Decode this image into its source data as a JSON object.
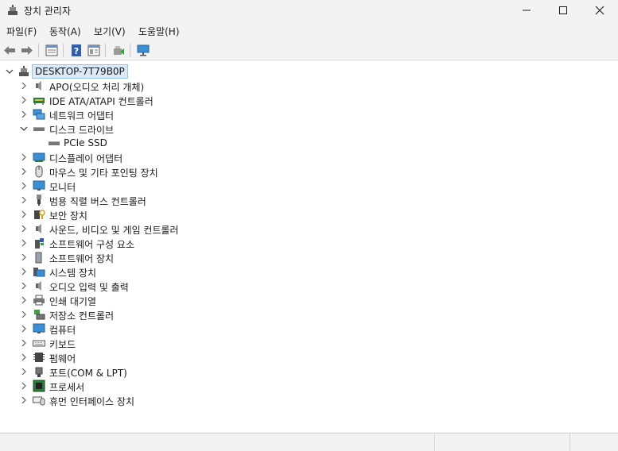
{
  "window": {
    "title": "장치 관리자"
  },
  "menu": [
    {
      "label": "파일(F)"
    },
    {
      "label": "동작(A)"
    },
    {
      "label": "보기(V)"
    },
    {
      "label": "도움말(H)"
    }
  ],
  "toolbar": {
    "icons": [
      "back-arrow-icon",
      "forward-arrow-icon",
      "properties-icon",
      "help-icon",
      "view-icon",
      "update-driver-icon",
      "monitor-scan-icon"
    ]
  },
  "tree": {
    "root": {
      "label": "DESKTOP-7T79B0P",
      "expanded": true
    },
    "categories": [
      {
        "label": "APO(오디오 처리 개체)",
        "expanded": false,
        "icon": "speaker-icon"
      },
      {
        "label": "IDE ATA/ATAPI 컨트롤러",
        "expanded": false,
        "icon": "ide-controller-icon"
      },
      {
        "label": "네트워크 어댑터",
        "expanded": false,
        "icon": "network-adapter-icon"
      },
      {
        "label": "디스크 드라이브",
        "expanded": true,
        "icon": "disk-drive-icon",
        "children": [
          {
            "label": "PCIe SSD",
            "icon": "disk-drive-icon"
          }
        ]
      },
      {
        "label": "디스플레이 어댑터",
        "expanded": false,
        "icon": "display-adapter-icon"
      },
      {
        "label": "마우스 및 기타 포인팅 장치",
        "expanded": false,
        "icon": "mouse-icon"
      },
      {
        "label": "모니터",
        "expanded": false,
        "icon": "monitor-icon"
      },
      {
        "label": "범용 직렬 버스 컨트롤러",
        "expanded": false,
        "icon": "usb-icon"
      },
      {
        "label": "보안 장치",
        "expanded": false,
        "icon": "security-device-icon"
      },
      {
        "label": "사운드, 비디오 및 게임 컨트롤러",
        "expanded": false,
        "icon": "speaker-icon"
      },
      {
        "label": "소프트웨어 구성 요소",
        "expanded": false,
        "icon": "software-component-icon"
      },
      {
        "label": "소프트웨어 장치",
        "expanded": false,
        "icon": "software-device-icon"
      },
      {
        "label": "시스템 장치",
        "expanded": false,
        "icon": "system-device-icon"
      },
      {
        "label": "오디오 입력 및 출력",
        "expanded": false,
        "icon": "speaker-icon"
      },
      {
        "label": "인쇄 대기열",
        "expanded": false,
        "icon": "printer-icon"
      },
      {
        "label": "저장소 컨트롤러",
        "expanded": false,
        "icon": "storage-controller-icon"
      },
      {
        "label": "컴퓨터",
        "expanded": false,
        "icon": "computer-icon"
      },
      {
        "label": "키보드",
        "expanded": false,
        "icon": "keyboard-icon"
      },
      {
        "label": "펌웨어",
        "expanded": false,
        "icon": "firmware-icon"
      },
      {
        "label": "포트(COM & LPT)",
        "expanded": false,
        "icon": "port-icon"
      },
      {
        "label": "프로세서",
        "expanded": false,
        "icon": "processor-icon"
      },
      {
        "label": "휴먼 인터페이스 장치",
        "expanded": false,
        "icon": "hid-icon"
      }
    ]
  },
  "colors": {
    "selection_bg": "#dce9f7",
    "selection_border": "#99c2ea",
    "window_bg": "#f3f3f3",
    "tree_bg": "#ffffff"
  }
}
